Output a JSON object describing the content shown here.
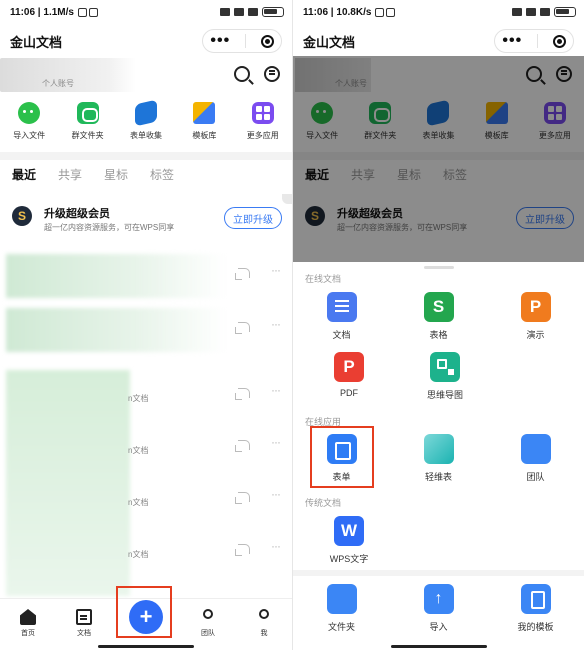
{
  "left": {
    "status": {
      "time_speed": "11:06 | 1.1M/s",
      "battery": ""
    },
    "app_title": "金山文档",
    "account_label": "个人账号",
    "quick_actions": [
      {
        "label": "导入文件",
        "icon": "wechat-icon"
      },
      {
        "label": "群文件夹",
        "icon": "group-folder-icon"
      },
      {
        "label": "表单收集",
        "icon": "form-collect-icon"
      },
      {
        "label": "模板库",
        "icon": "template-icon"
      },
      {
        "label": "更多应用",
        "icon": "more-apps-icon"
      }
    ],
    "tabs": [
      "最近",
      "共享",
      "星标",
      "标签"
    ],
    "promo": {
      "icon_letter": "S",
      "title": "升级超级会员",
      "subtitle": "超一亿内容资源服务，可在WPS同享",
      "button": "立即升级"
    },
    "files": [
      {
        "type": ""
      },
      {
        "type": ""
      },
      {
        "type": "n文档"
      },
      {
        "type": "n文档"
      },
      {
        "type": "n文档"
      },
      {
        "type": "n文档"
      },
      {
        "type": "n文档"
      }
    ],
    "nav": [
      {
        "label": "首页",
        "icon": "home-icon"
      },
      {
        "label": "文档",
        "icon": "document-icon"
      },
      {
        "label": "团队",
        "icon": "team-icon"
      },
      {
        "label": "我",
        "icon": "profile-icon"
      }
    ],
    "fab_symbol": "+"
  },
  "right": {
    "status": {
      "time_speed": "11:06 | 10.8K/s"
    },
    "app_title": "金山文档",
    "account_label": "个人账号",
    "quick_actions": [
      {
        "label": "导入文件"
      },
      {
        "label": "群文件夹"
      },
      {
        "label": "表单收集"
      },
      {
        "label": "模板库"
      },
      {
        "label": "更多应用"
      }
    ],
    "tabs": [
      "最近",
      "共享",
      "星标",
      "标签"
    ],
    "promo": {
      "icon_letter": "S",
      "title": "升级超级会员",
      "subtitle": "超一亿内容资源服务，可在WPS同享",
      "button": "立即升级"
    },
    "sheet": {
      "online_docs_title": "在线文档",
      "online_docs": [
        {
          "label": "文档",
          "icon": "doc-icon",
          "glyph": ""
        },
        {
          "label": "表格",
          "icon": "sheet-icon",
          "glyph": "S"
        },
        {
          "label": "演示",
          "icon": "presentation-icon",
          "glyph": "P"
        },
        {
          "label": "PDF",
          "icon": "pdf-icon",
          "glyph": "P"
        },
        {
          "label": "思维导图",
          "icon": "mindmap-icon",
          "glyph": ""
        }
      ],
      "online_apps_title": "在线应用",
      "online_apps": [
        {
          "label": "表单",
          "icon": "form-icon",
          "glyph": ""
        },
        {
          "label": "轻维表",
          "icon": "light-table-icon",
          "glyph": ""
        },
        {
          "label": "团队",
          "icon": "team-icon",
          "glyph": ""
        }
      ],
      "legacy_title": "传统文档",
      "legacy": [
        {
          "label": "WPS文字",
          "icon": "wps-word-icon",
          "glyph": "W"
        }
      ],
      "bottom": [
        {
          "label": "文件夹",
          "icon": "folder-icon"
        },
        {
          "label": "导入",
          "icon": "import-icon"
        },
        {
          "label": "我的模板",
          "icon": "my-template-icon"
        }
      ]
    }
  },
  "colors": {
    "accent": "#2f6cf6",
    "highlight": "#e53d1f",
    "promo_button": "#3a7bf3"
  }
}
